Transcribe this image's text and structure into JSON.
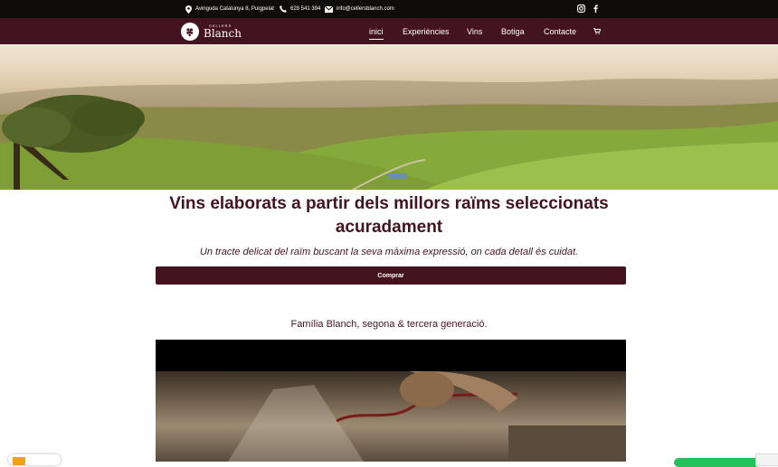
{
  "topbar": {
    "address": "Avinguda Catalunya 8, Puigpelat",
    "phone": "628 541 394",
    "email": "info@cellersblanch.com",
    "social": [
      {
        "icon": "instagram-icon"
      },
      {
        "icon": "facebook-icon"
      }
    ]
  },
  "brand": {
    "small": "CELLERS",
    "name": "Blanch",
    "icon": "grape-icon"
  },
  "nav": {
    "items": [
      {
        "label": "inici",
        "active": true
      },
      {
        "label": "Experiències",
        "active": false
      },
      {
        "label": "Vins",
        "active": false
      },
      {
        "label": "Botiga",
        "active": false
      },
      {
        "label": "Contacte",
        "active": false
      }
    ],
    "cart_icon": "cart-icon"
  },
  "main": {
    "headline": "Vins elaborats a partir dels millors raïms seleccionats acuradament",
    "subheadline": "Un tracte delicat del raïm buscant la seva màxima expressió, on cada detall és cuidat.",
    "cta_label": "Comprar",
    "family_line": "Família Blanch, segona & tercera generació."
  },
  "colors": {
    "brand": "#43141f",
    "topbar": "#0f0c0c",
    "chat": "#25c05a"
  }
}
